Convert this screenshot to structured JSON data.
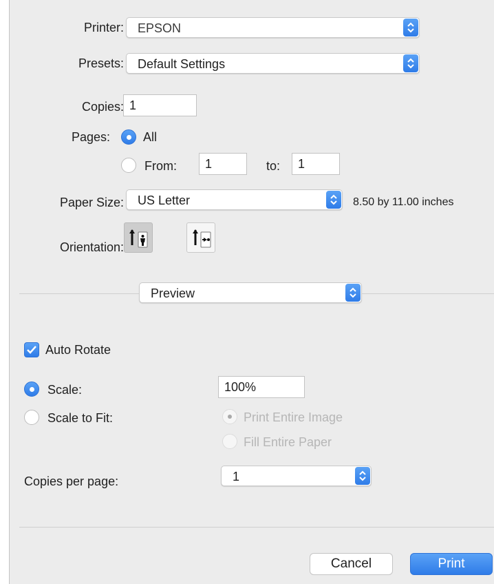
{
  "printer": {
    "label": "Printer:",
    "value": "EPSON"
  },
  "presets": {
    "label": "Presets:",
    "value": "Default Settings"
  },
  "copies": {
    "label": "Copies:",
    "value": "1"
  },
  "pages": {
    "label": "Pages:",
    "all_label": "All",
    "from_label": "From:",
    "from_value": "1",
    "to_label": "to:",
    "to_value": "1",
    "selected": "All"
  },
  "paper_size": {
    "label": "Paper Size:",
    "value": "US Letter",
    "dimensions": "8.50 by 11.00 inches"
  },
  "orientation": {
    "label": "Orientation:",
    "selected": "portrait"
  },
  "section_popup": {
    "value": "Preview"
  },
  "auto_rotate": {
    "label": "Auto Rotate",
    "checked": true
  },
  "scale": {
    "label": "Scale:",
    "value": "100%",
    "selected": true
  },
  "scale_to_fit": {
    "label": "Scale to Fit:",
    "print_entire_image": "Print Entire Image",
    "fill_entire_paper": "Fill Entire Paper"
  },
  "copies_per_page": {
    "label": "Copies per page:",
    "value": "1"
  },
  "buttons": {
    "cancel": "Cancel",
    "print": "Print"
  },
  "colors": {
    "accent": "#2f7ce8",
    "panel": "#ececec"
  }
}
